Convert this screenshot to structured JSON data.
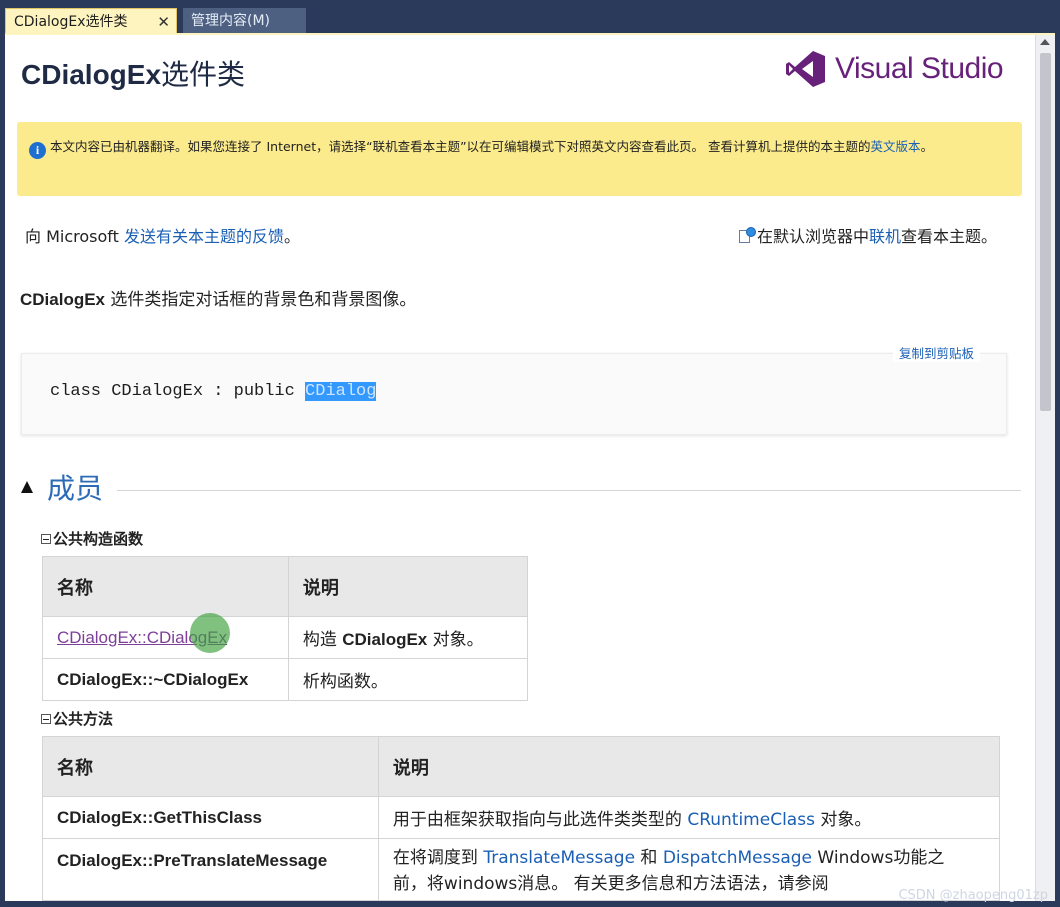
{
  "tabs": [
    {
      "label": "CDialogEx选件类",
      "active": true
    },
    {
      "label": "管理内容(M)",
      "active": false
    }
  ],
  "tab_close_glyph": "✕",
  "page": {
    "title_code": "CDialogEx",
    "title_cjk": "选件类",
    "logo_text": "Visual Studio",
    "logo_color": "#68217a"
  },
  "notice": {
    "text_before_link": "本文内容已由机器翻译。如果您连接了 Internet，请选择“联机查看本主题”以在可编辑模式下对照英文内容查看此页。 查看计算机上提供的本主题的",
    "link": "英文版本",
    "text_after_link": "。",
    "icon": "info-icon"
  },
  "feedback": {
    "prefix": "向 Microsoft ",
    "link": "发送有关本主题的反馈",
    "suffix": "。"
  },
  "online": {
    "prefix": "在默认浏览器中",
    "link": "联机",
    "suffix": "查看本主题。",
    "icon": "external-view-icon"
  },
  "intro": {
    "bold": "CDialogEx",
    "text": " 选件类指定对话框的背景色和背景图像。"
  },
  "code_block": {
    "copy_label": "复制到剪贴板",
    "code_prefix": "class CDialogEx : public ",
    "code_selected": "CDialog"
  },
  "members": {
    "title": "成员",
    "constructors": {
      "heading": "公共构造函数",
      "col_name": "名称",
      "col_desc": "说明",
      "rows": [
        {
          "name": "CDialogEx::CDialogEx",
          "desc_prefix": "构造 ",
          "desc_bold": "CDialogEx",
          "desc_suffix": " 对象。"
        },
        {
          "name": "CDialogEx::~CDialogEx",
          "desc": "析构函数。"
        }
      ]
    },
    "methods": {
      "heading": "公共方法",
      "col_name": "名称",
      "col_desc": "说明",
      "rows": [
        {
          "name": "CDialogEx::GetThisClass",
          "desc_prefix": "用于由框架获取指向与此选件类类型的 ",
          "desc_link": "CRuntimeClass",
          "desc_suffix": " 对象。"
        },
        {
          "name": "CDialogEx::PreTranslateMessage",
          "desc_prefix": "在将调度到 ",
          "desc_link1": "TranslateMessage",
          "desc_mid": " 和 ",
          "desc_link2": "DispatchMessage",
          "desc_suffix_line1": " Windows功能之",
          "desc_line2": "前，将windows消息。 有关更多信息和方法语法，请参阅"
        }
      ]
    }
  },
  "watermark": "CSDN @zhaopeng01zp"
}
